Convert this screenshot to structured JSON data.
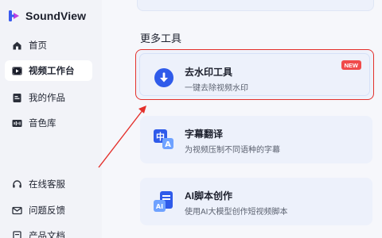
{
  "app": {
    "name": "SoundView",
    "brand_color": "#3a5bf0"
  },
  "sidebar": {
    "items": [
      {
        "label": "首页",
        "icon": "home-icon"
      },
      {
        "label": "视频工作台",
        "icon": "video-workbench-icon",
        "active": true
      },
      {
        "label": "我的作品",
        "icon": "works-icon"
      },
      {
        "label": "音色库",
        "icon": "voice-library-icon"
      },
      {
        "label": "在线客服",
        "icon": "headset-icon"
      },
      {
        "label": "问题反馈",
        "icon": "mail-icon"
      },
      {
        "label": "产品文档",
        "icon": "document-icon"
      }
    ]
  },
  "main": {
    "section_title": "更多工具",
    "tools": [
      {
        "title": "去水印工具",
        "subtitle": "一键去除视频水印",
        "badge": "NEW",
        "icon": "download-circle-icon",
        "highlighted": true
      },
      {
        "title": "字幕翻译",
        "subtitle": "为视频压制不同语种的字幕",
        "icon": "translate-icon"
      },
      {
        "title": "AI脚本创作",
        "subtitle": "使用AI大模型创作短视频脚本",
        "icon": "ai-script-icon"
      }
    ]
  },
  "annotation": {
    "color": "#e4302b"
  }
}
